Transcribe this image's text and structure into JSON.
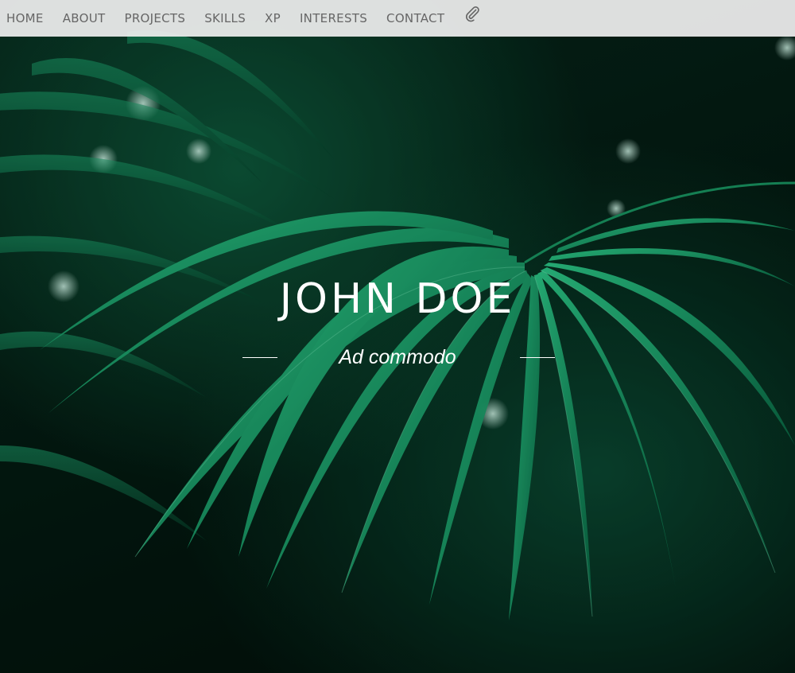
{
  "nav": {
    "items": [
      {
        "label": "HOME"
      },
      {
        "label": "ABOUT"
      },
      {
        "label": "PROJECTS"
      },
      {
        "label": "SKILLS"
      },
      {
        "label": "XP"
      },
      {
        "label": "INTERESTS"
      },
      {
        "label": "CONTACT"
      }
    ],
    "icon": "paperclip-icon"
  },
  "hero": {
    "title": "JOHN DOE",
    "subtitle": "Ad commodo",
    "background": "palm-leaves-photo"
  },
  "colors": {
    "navbar_bg": "#eeeeee",
    "nav_text": "#666666",
    "hero_text": "#ffffff",
    "leaf_green": "#1db57a"
  }
}
